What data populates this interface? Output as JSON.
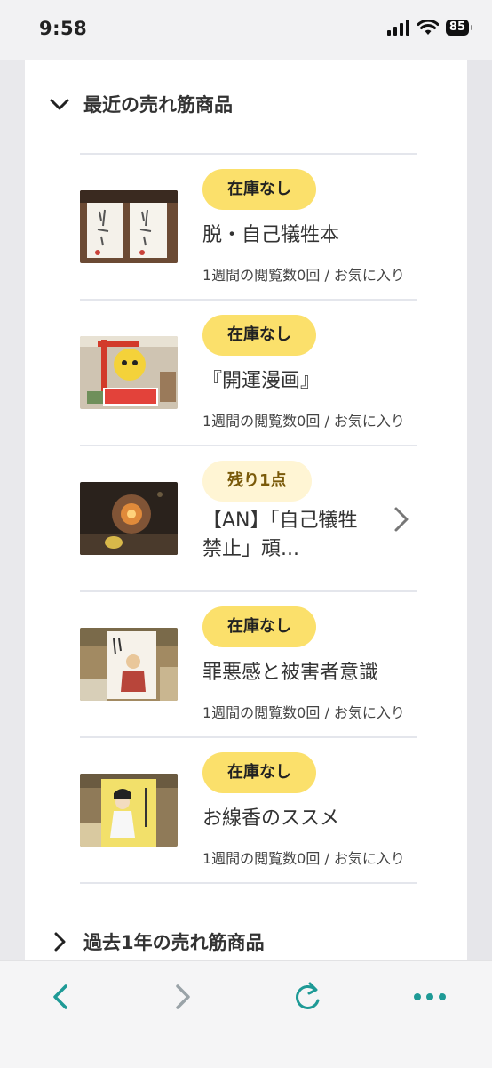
{
  "status_bar": {
    "time": "9:58",
    "battery": "85"
  },
  "recent_section": {
    "title": "最近の売れ筋商品",
    "items": [
      {
        "badge": "在庫なし",
        "title": "脱・自己犠牲本",
        "meta": "1週間の閲覧数0回 / お気に入り"
      },
      {
        "badge": "在庫なし",
        "title": "『開運漫画』",
        "meta": "1週間の閲覧数0回 / お気に入り"
      },
      {
        "badge": "残り1点",
        "title": "【AN】「自己犠牲禁止」頑...",
        "meta": ""
      },
      {
        "badge": "在庫なし",
        "title": "罪悪感と被害者意識",
        "meta": "1週間の閲覧数0回 / お気に入り"
      },
      {
        "badge": "在庫なし",
        "title": "お線香のススメ",
        "meta": "1週間の閲覧数0回 / お気に入り"
      }
    ]
  },
  "past_year_section": {
    "title": "過去1年の売れ筋商品"
  },
  "colors": {
    "badge_out_of_stock": "#fbe06b",
    "badge_remaining": "#fff5d4",
    "toolbar_accent": "#1e9a96"
  },
  "toolbar": {
    "icons": [
      "back-icon",
      "forward-icon",
      "reload-icon",
      "more-icon"
    ]
  }
}
